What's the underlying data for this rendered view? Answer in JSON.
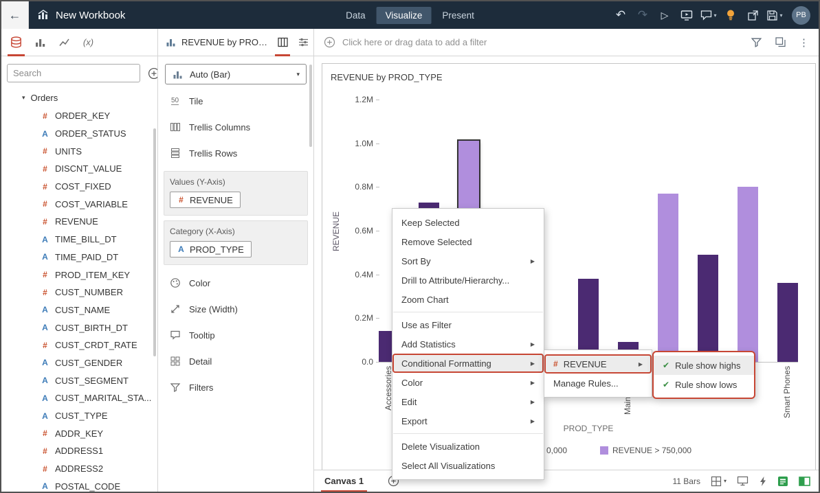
{
  "colors": {
    "accent": "#c74634",
    "bar_high": "#b08edd",
    "bar_low": "#4b2a72",
    "measure": "#c9502c",
    "attribute": "#3e7cb8",
    "check_green": "#3a8e43"
  },
  "header": {
    "title": "New Workbook",
    "tabs": [
      "Data",
      "Visualize",
      "Present"
    ],
    "selected_tab": "Visualize",
    "actions": [
      {
        "icon": "undo"
      },
      {
        "icon": "redo",
        "disabled": true
      },
      {
        "icon": "preview"
      },
      {
        "icon": "present"
      },
      {
        "icon": "comments",
        "caret": true
      },
      {
        "icon": "insights"
      },
      {
        "icon": "pop-out"
      },
      {
        "icon": "save",
        "caret": true
      }
    ],
    "avatar": "PB"
  },
  "data_panel": {
    "search_placeholder": "Search",
    "root_label": "Orders",
    "tools": [
      {
        "icon": "dataset",
        "selected": true
      },
      {
        "icon": "bar-chart"
      },
      {
        "icon": "line-chart"
      },
      {
        "icon": "fx"
      }
    ],
    "fields": [
      {
        "type": "measure",
        "name": "ORDER_KEY"
      },
      {
        "type": "attribute",
        "name": "ORDER_STATUS"
      },
      {
        "type": "measure",
        "name": "UNITS"
      },
      {
        "type": "measure",
        "name": "DISCNT_VALUE"
      },
      {
        "type": "measure",
        "name": "COST_FIXED"
      },
      {
        "type": "measure",
        "name": "COST_VARIABLE"
      },
      {
        "type": "measure",
        "name": "REVENUE"
      },
      {
        "type": "attribute",
        "name": "TIME_BILL_DT"
      },
      {
        "type": "attribute",
        "name": "TIME_PAID_DT"
      },
      {
        "type": "measure",
        "name": "PROD_ITEM_KEY"
      },
      {
        "type": "measure",
        "name": "CUST_NUMBER"
      },
      {
        "type": "attribute",
        "name": "CUST_NAME"
      },
      {
        "type": "attribute",
        "name": "CUST_BIRTH_DT"
      },
      {
        "type": "measure",
        "name": "CUST_CRDT_RATE"
      },
      {
        "type": "attribute",
        "name": "CUST_GENDER"
      },
      {
        "type": "attribute",
        "name": "CUST_SEGMENT"
      },
      {
        "type": "attribute",
        "name": "CUST_MARITAL_STA..."
      },
      {
        "type": "attribute",
        "name": "CUST_TYPE"
      },
      {
        "type": "measure",
        "name": "ADDR_KEY"
      },
      {
        "type": "measure",
        "name": "ADDRESS1"
      },
      {
        "type": "measure",
        "name": "ADDRESS2"
      },
      {
        "type": "attribute",
        "name": "POSTAL_CODE"
      }
    ]
  },
  "grammar_panel": {
    "title": "REVENUE by PROD_...",
    "viz_type_label": "Auto (Bar)",
    "header_tabs": [
      {
        "icon": "grammar",
        "selected": true
      },
      {
        "icon": "properties"
      }
    ],
    "top_rows": [
      {
        "icon": "tile",
        "label": "Tile"
      },
      {
        "icon": "trellis-columns",
        "label": "Trellis Columns"
      },
      {
        "icon": "trellis-rows",
        "label": "Trellis Rows"
      }
    ],
    "values_section": {
      "label": "Values (Y-Axis)",
      "pill": {
        "type": "measure",
        "name": "REVENUE"
      }
    },
    "category_section": {
      "label": "Category (X-Axis)",
      "pill": {
        "type": "attribute",
        "name": "PROD_TYPE"
      }
    },
    "bottom_rows": [
      {
        "icon": "color",
        "label": "Color"
      },
      {
        "icon": "size",
        "label": "Size (Width)"
      },
      {
        "icon": "tooltip",
        "label": "Tooltip"
      },
      {
        "icon": "detail",
        "label": "Detail"
      },
      {
        "icon": "filters",
        "label": "Filters"
      }
    ]
  },
  "filter_bar": {
    "prompt": "Click here or drag data to add a filter",
    "icons": [
      "filter",
      "layers",
      "menu-dots"
    ]
  },
  "chart_data": {
    "type": "bar",
    "title": "REVENUE by PROD_TYPE",
    "xlabel": "PROD_TYPE",
    "ylabel": "REVENUE",
    "y_ticks": [
      "1.2M",
      "1.0M",
      "0.8M",
      "0.6M",
      "0.4M",
      "0.2M",
      "0.0"
    ],
    "ylim": [
      0,
      1200000
    ],
    "bar_count": 11,
    "bars": [
      {
        "category": "Accessories",
        "value": 140000,
        "color": "low"
      },
      {
        "category": "",
        "value": 730000,
        "color": "low"
      },
      {
        "category": "",
        "value": 1010000,
        "color": "high",
        "selected": true
      },
      {
        "category": "",
        "value": null
      },
      {
        "category": "",
        "value": null
      },
      {
        "category": "",
        "value": 380000,
        "color": "low"
      },
      {
        "category": "Main",
        "value": 90000,
        "color": "low",
        "label_offset": 45
      },
      {
        "category": "",
        "value": 770000,
        "color": "high"
      },
      {
        "category": "",
        "value": 490000,
        "color": "low"
      },
      {
        "category": "",
        "value": 800000,
        "color": "high"
      },
      {
        "category": "Smart Phones",
        "value": 360000,
        "color": "low"
      }
    ],
    "legend": [
      {
        "label": "0,000",
        "swatch": null
      },
      {
        "label": "REVENUE > 750,000",
        "swatch": "#b08edd"
      }
    ],
    "legend_position": "bottom"
  },
  "context_menu": {
    "items": [
      {
        "label": "Keep Selected"
      },
      {
        "label": "Remove Selected"
      },
      {
        "label": "Sort By",
        "arrow": true
      },
      {
        "label": "Drill to Attribute/Hierarchy..."
      },
      {
        "label": "Zoom Chart",
        "sep_after": true
      },
      {
        "label": "Use as Filter"
      },
      {
        "label": "Add Statistics",
        "arrow": true
      },
      {
        "label": "Conditional Formatting",
        "arrow": true,
        "annotated": true,
        "hover": true
      },
      {
        "label": "Color",
        "arrow": true
      },
      {
        "label": "Edit",
        "arrow": true
      },
      {
        "label": "Export",
        "arrow": true,
        "sep_after": true
      },
      {
        "label": "Delete Visualization"
      },
      {
        "label": "Select All Visualizations"
      }
    ]
  },
  "field_submenu": {
    "items": [
      {
        "label": "REVENUE",
        "icon": "measure",
        "arrow": true,
        "annotated": true,
        "hover": true
      },
      {
        "label": "Manage Rules..."
      }
    ]
  },
  "rules_submenu": {
    "items": [
      {
        "label": "Rule show highs",
        "checked": true,
        "hover": true
      },
      {
        "label": "Rule show lows",
        "checked": true
      }
    ]
  },
  "bottom_bar": {
    "canvas_tab": "Canvas 1",
    "status": "11 Bars",
    "icons": [
      {
        "icon": "layout-grid",
        "caret": true
      },
      {
        "icon": "present-view"
      },
      {
        "icon": "insights-bolt"
      },
      {
        "icon": "grid-active"
      },
      {
        "icon": "split-view"
      }
    ]
  }
}
